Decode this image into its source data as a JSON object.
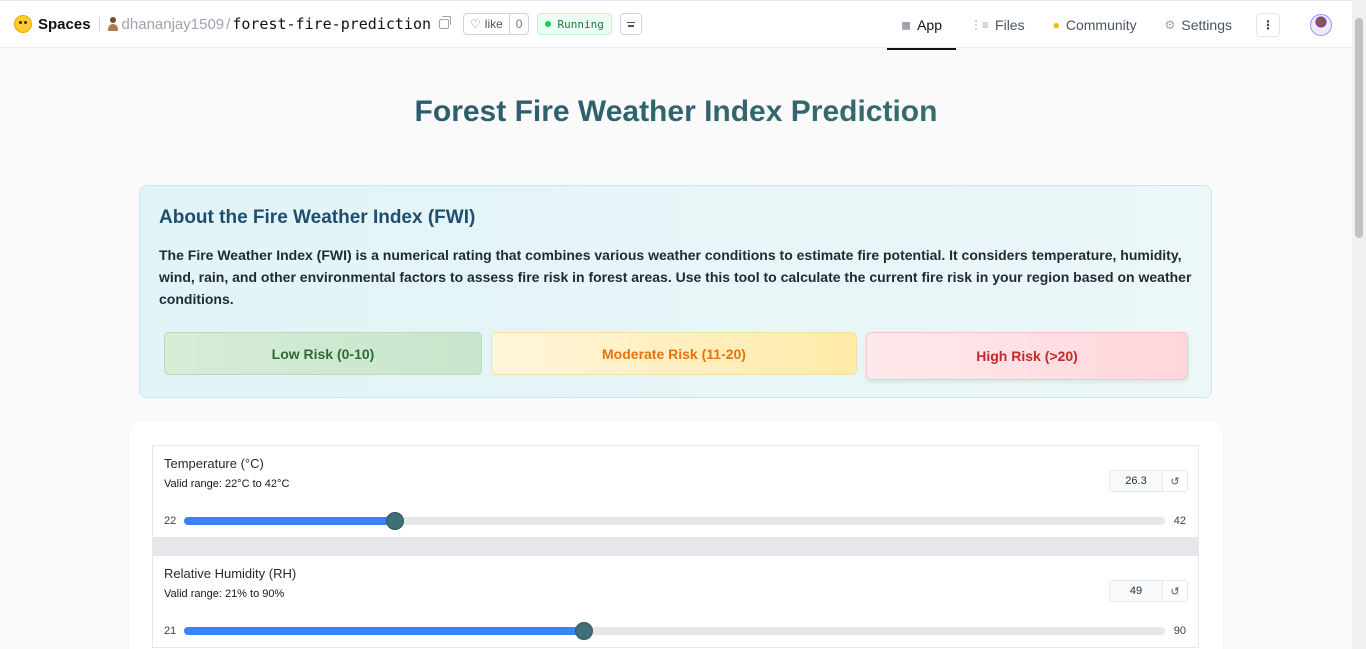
{
  "topbar": {
    "brand": "Spaces",
    "owner": "dhananjay1509",
    "repo": "forest-fire-prediction",
    "like_label": "like",
    "like_count": "0",
    "status": "Running",
    "tabs": [
      {
        "label": "App",
        "icon": "cube-icon",
        "active": true
      },
      {
        "label": "Files",
        "icon": "files-icon",
        "active": false
      },
      {
        "label": "Community",
        "icon": "community-icon",
        "active": false
      },
      {
        "label": "Settings",
        "icon": "gear-icon",
        "active": false
      }
    ]
  },
  "page": {
    "title": "Forest Fire Weather Index Prediction"
  },
  "about": {
    "heading": "About the Fire Weather Index (FWI)",
    "body": "The Fire Weather Index (FWI) is a numerical rating that combines various weather conditions to estimate fire potential. It considers temperature, humidity, wind, rain, and other environmental factors to assess fire risk in forest areas. Use this tool to calculate the current fire risk in your region based on weather conditions.",
    "risks": [
      {
        "label": "Low Risk (0-10)",
        "color": "#2e6b30"
      },
      {
        "label": "Moderate Risk (11-20)",
        "color": "#e8730c"
      },
      {
        "label": "High Risk (>20)",
        "color": "#c62828"
      }
    ]
  },
  "inputs": [
    {
      "label": "Temperature (°C)",
      "hint": "Valid range: 22°C to 42°C",
      "value": "26.3",
      "min": "22",
      "max": "42",
      "fraction": 0.215
    },
    {
      "label": "Relative Humidity (RH)",
      "hint": "Valid range: 21% to 90%",
      "value": "49",
      "min": "21",
      "max": "90",
      "fraction": 0.408
    }
  ],
  "colors": {
    "accent": "#3b82f6",
    "title_gradient_start": "#234e6f",
    "title_gradient_end": "#3d7a6c",
    "status_green": "#22c55e"
  }
}
